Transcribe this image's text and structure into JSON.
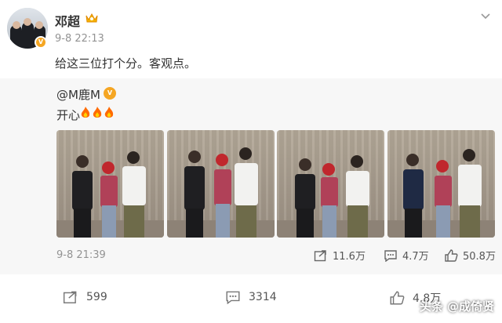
{
  "post": {
    "username": "邓超",
    "time": "9-8 22:13",
    "text": "给这三位打个分。客观点。",
    "verified_icon": "vip-crown-icon"
  },
  "repost": {
    "username": "@M鹿M",
    "text": "开心",
    "emoji": "fire-emoji",
    "time": "9-8 21:39",
    "actions": {
      "share": "11.6万",
      "comment": "4.7万",
      "like": "50.8万"
    },
    "photo_count": 4
  },
  "footer": {
    "share": "599",
    "comment": "3314",
    "like": "4.8万"
  },
  "watermark": {
    "text": "头条 @成倚贤"
  },
  "colors": {
    "accent_orange": "#f5a623",
    "muted": "#939393",
    "repost_bg": "#f7f7f7"
  }
}
